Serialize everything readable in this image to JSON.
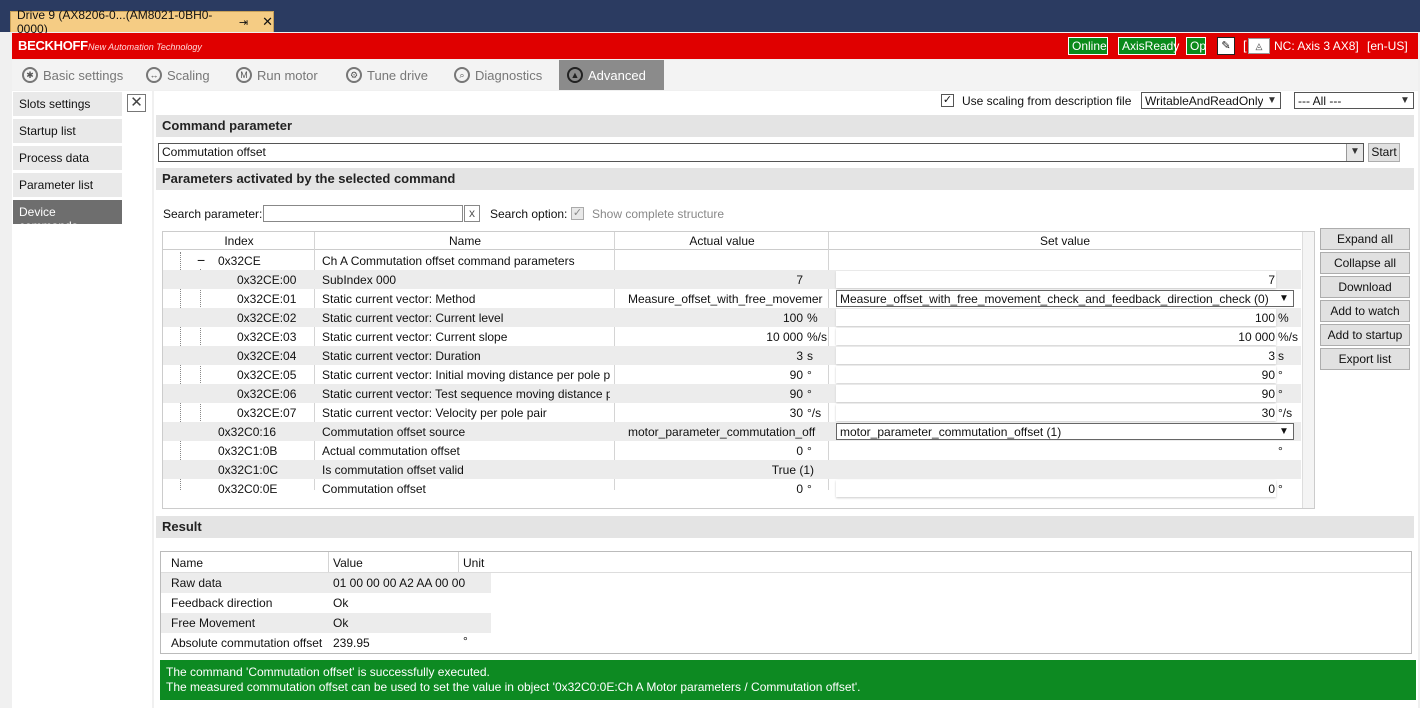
{
  "doc_tab": {
    "title": "Drive 9 (AX8206-0...(AM8021-0BH0-0000)",
    "pin": "⇥",
    "close": "✕"
  },
  "header": {
    "brand": "BECKHOFF",
    "brand_sub": "New Automation Technology",
    "status_online": "Online",
    "status_axis": "AxisReady",
    "status_op": "Op",
    "nc_bracket": "[",
    "nc_axis": "NC: Axis 3 AX8]",
    "language": "[en-US]",
    "colors": {
      "red": "#e00000",
      "status_green": "#0a8a1a"
    }
  },
  "toolbar": {
    "tabs": [
      {
        "label": "Basic settings",
        "icon": "gear-icon"
      },
      {
        "label": "Scaling",
        "icon": "scale-icon"
      },
      {
        "label": "Run motor",
        "icon": "motor-icon"
      },
      {
        "label": "Tune drive",
        "icon": "gears-icon"
      },
      {
        "label": "Diagnostics",
        "icon": "magnifier-icon"
      },
      {
        "label": "Advanced",
        "icon": "graduation-cap-icon",
        "active": true
      }
    ]
  },
  "sidebar": {
    "items": [
      {
        "label": "Slots settings"
      },
      {
        "label": "Startup list"
      },
      {
        "label": "Process data"
      },
      {
        "label": "Parameter list"
      },
      {
        "label": "Device commands",
        "active": true
      }
    ]
  },
  "options": {
    "use_scaling_label": "Use scaling from description file",
    "use_scaling_checked": true,
    "access_filter": "WritableAndReadOnly",
    "group_filter": "--- All ---"
  },
  "command": {
    "section_title": "Command parameter",
    "selected": "Commutation offset",
    "start_label": "Start",
    "params_title": "Parameters activated by the selected command"
  },
  "search": {
    "label": "Search parameter:",
    "value": "",
    "clear": "x",
    "option_label": "Search option:",
    "show_structure_label": "Show complete structure",
    "show_structure_checked": true
  },
  "param_table": {
    "headers": [
      "Index",
      "Name",
      "Actual value",
      "Set value"
    ],
    "rows": [
      {
        "index": "0x32CE",
        "name": "Ch A Commutation offset command parameters",
        "actual": "",
        "actual_unit": "",
        "set": "",
        "set_unit": "",
        "expander": "−"
      },
      {
        "index": "0x32CE:00",
        "name": "SubIndex 000",
        "actual": "7",
        "actual_unit": "",
        "set": "7",
        "set_unit": ""
      },
      {
        "index": "0x32CE:01",
        "name": "Static current vector: Method",
        "actual": "Measure_offset_with_free_movemer",
        "actual_unit": "",
        "set": "Measure_offset_with_free_movement_check_and_feedback_direction_check (0)",
        "set_unit": "",
        "set_type": "select"
      },
      {
        "index": "0x32CE:02",
        "name": "Static current vector: Current level",
        "actual": "100",
        "actual_unit": "%",
        "set": "100",
        "set_unit": "%"
      },
      {
        "index": "0x32CE:03",
        "name": "Static current vector: Current slope",
        "actual": "10 000",
        "actual_unit": "%/s",
        "set": "10 000",
        "set_unit": "%/s"
      },
      {
        "index": "0x32CE:04",
        "name": "Static current vector: Duration",
        "actual": "3",
        "actual_unit": "s",
        "set": "3",
        "set_unit": "s"
      },
      {
        "index": "0x32CE:05",
        "name": "Static current vector: Initial moving distance per pole p",
        "actual": "90",
        "actual_unit": "°",
        "set": "90",
        "set_unit": "°"
      },
      {
        "index": "0x32CE:06",
        "name": "Static current vector: Test sequence moving distance p",
        "actual": "90",
        "actual_unit": "°",
        "set": "90",
        "set_unit": "°"
      },
      {
        "index": "0x32CE:07",
        "name": "Static current vector: Velocity per pole pair",
        "actual": "30",
        "actual_unit": "°/s",
        "set": "30",
        "set_unit": "°/s"
      },
      {
        "index": "0x32C0:16",
        "name": "Commutation offset source",
        "actual": "motor_parameter_commutation_off",
        "actual_unit": "",
        "set": "motor_parameter_commutation_offset (1)",
        "set_unit": "",
        "set_type": "select"
      },
      {
        "index": "0x32C1:0B",
        "name": "Actual commutation offset",
        "actual": "0",
        "actual_unit": "°",
        "set": "",
        "set_unit": "°"
      },
      {
        "index": "0x32C1:0C",
        "name": "Is commutation offset valid",
        "actual": "True (1)",
        "actual_unit": "",
        "set": "",
        "set_unit": ""
      },
      {
        "index": "0x32C0:0E",
        "name": "Commutation offset",
        "actual": "0",
        "actual_unit": "°",
        "set": "0",
        "set_unit": "°"
      }
    ]
  },
  "side_buttons": [
    "Expand all",
    "Collapse all",
    "Download",
    "Add to watch",
    "Add to startup",
    "Export list"
  ],
  "result": {
    "title": "Result",
    "headers": [
      "Name",
      "Value",
      "Unit"
    ],
    "rows": [
      {
        "name": "Raw data",
        "value": "01 00 00 00 A2 AA 00 00",
        "unit": ""
      },
      {
        "name": "Feedback direction",
        "value": "Ok",
        "unit": ""
      },
      {
        "name": "Free Movement",
        "value": "Ok",
        "unit": ""
      },
      {
        "name": "Absolute commutation offset",
        "value": "239.95",
        "unit": "°"
      }
    ]
  },
  "message": {
    "line1": "The command 'Commutation offset' is successfully executed.",
    "line2": "The measured commutation offset can be used to set the value in object '0x32C0:0E:Ch A Motor parameters / Commutation offset'.",
    "color": "#0d8a22"
  }
}
